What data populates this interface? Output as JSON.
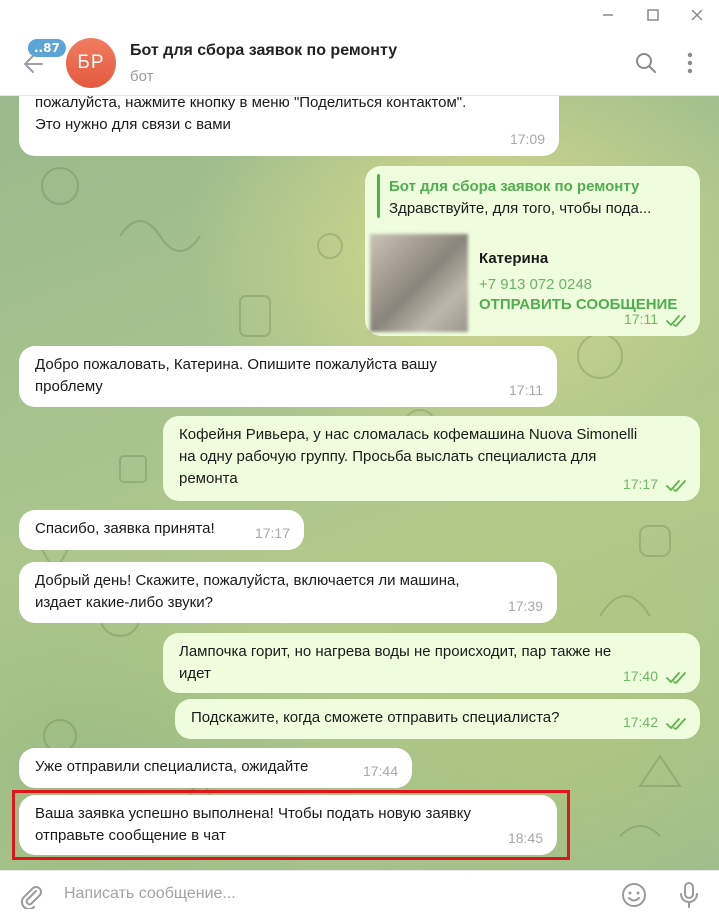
{
  "header": {
    "unread_count": "..87",
    "avatar_initials": "БР",
    "title": "Бот для сбора заявок по ремонту",
    "subtitle": "бот"
  },
  "messages": [
    {
      "direction": "in",
      "text": "пожалуйста, нажмите кнопку в меню \"Поделиться контактом\".",
      "text2": "Это нужно для связи с вами",
      "time": "17:09"
    },
    {
      "direction": "out",
      "forwarded_from": "Бот для сбора заявок по ремонту",
      "forwarded_text": "Здравствуйте, для того, чтобы пода...",
      "contact_name": "Катерина",
      "contact_phone": "+7 913 072 0248",
      "contact_action": "ОТПРАВИТЬ СООБЩЕНИЕ",
      "time": "17:11",
      "read": true
    },
    {
      "direction": "in",
      "lines": [
        "Добро пожаловать, Катерина. Опишите пожалуйста вашу",
        "проблему"
      ],
      "time": "17:11"
    },
    {
      "direction": "out",
      "lines": [
        "Кофейня Ривьера, у нас сломалась кофемашина Nuova Simonelli",
        "на одну рабочую группу. Просьба выслать специалиста для",
        "ремонта"
      ],
      "time": "17:17",
      "read": true
    },
    {
      "direction": "in",
      "lines": [
        "Спасибо, заявка принята!"
      ],
      "time": "17:17"
    },
    {
      "direction": "in",
      "lines": [
        "Добрый день! Скажите, пожалуйста, включается ли машина,",
        "издает какие-либо звуки?"
      ],
      "time": "17:39"
    },
    {
      "direction": "out",
      "lines": [
        "Лампочка горит, но нагрева воды не происходит, пар также не",
        "идет"
      ],
      "time": "17:40",
      "read": true
    },
    {
      "direction": "out",
      "lines": [
        "Подскажите, когда сможете отправить специалиста?"
      ],
      "time": "17:42",
      "read": true
    },
    {
      "direction": "in",
      "lines": [
        "Уже отправили специалиста, ожидайте"
      ],
      "time": "17:44"
    },
    {
      "direction": "in",
      "lines": [
        "Ваша заявка успешно выполнена! Чтобы подать новую заявку",
        "отправьте сообщение в чат"
      ],
      "time": "18:45",
      "highlighted": true
    }
  ],
  "input": {
    "placeholder": "Написать сообщение..."
  },
  "colors": {
    "highlight_border": "#e0141c",
    "outgoing_bubble": "#effdde",
    "accent_green": "#4fae4e",
    "avatar": "#e86a4f"
  },
  "icons": {
    "window": [
      "minimize-icon",
      "maximize-icon",
      "close-icon"
    ],
    "header": [
      "back-arrow-icon",
      "search-icon",
      "more-vertical-icon"
    ],
    "input": [
      "attach-icon",
      "emoji-icon",
      "microphone-icon"
    ]
  }
}
